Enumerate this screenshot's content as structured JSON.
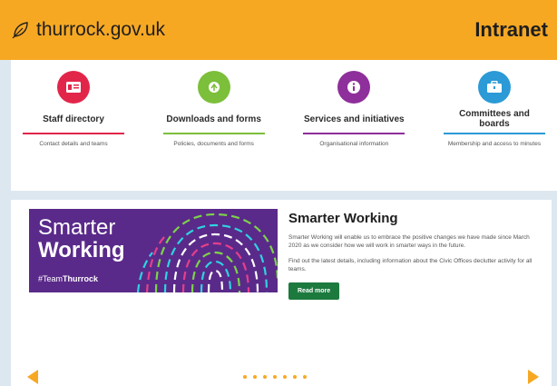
{
  "header": {
    "logo_text": "thurrock.gov.uk",
    "logo_icon": "leaf-icon",
    "section_title": "Intranet",
    "background_color": "#f7a823"
  },
  "quick_links": [
    {
      "title": "Staff directory",
      "description": "Contact details and teams",
      "icon": "id-card-icon",
      "color": "#e2264a"
    },
    {
      "title": "Downloads and forms",
      "description": "Policies, documents and forms",
      "icon": "document-icon",
      "color": "#7cbf3a"
    },
    {
      "title": "Services and initiatives",
      "description": "Organisational information",
      "icon": "info-icon",
      "color": "#8e2f9b"
    },
    {
      "title": "Committees and boards",
      "description": "Membership and access to minutes",
      "icon": "briefcase-icon",
      "color": "#2b9ad6"
    }
  ],
  "carousel": {
    "banner": {
      "word1": "Smarter",
      "word2": "Working",
      "hashtag_prefix": "#Team",
      "hashtag_bold": "Thurrock",
      "background_color": "#5a2a8a"
    },
    "feature": {
      "title": "Smarter Working",
      "paragraph1": "Smarter Working will enable us to embrace the positive changes we have made since March 2020 as we consider how we will work in smarter ways in the future.",
      "paragraph2": "Find out the latest details, including information about the Civic Offices declutter activity for all teams.",
      "button_label": "Read more",
      "button_color": "#1c7a3e"
    },
    "dot_count": 7,
    "prev_icon": "arrow-left-icon",
    "next_icon": "arrow-right-icon"
  }
}
